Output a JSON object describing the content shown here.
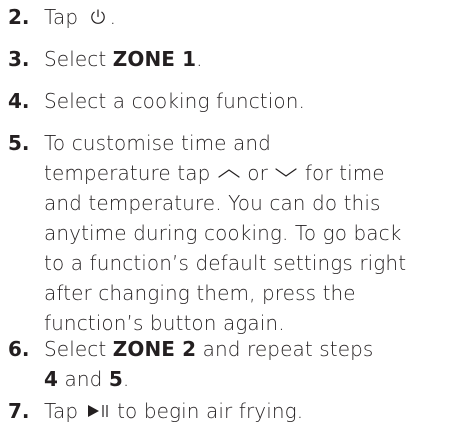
{
  "steps": [
    {
      "number": "2.",
      "pre": "Tap",
      "post": "."
    },
    {
      "number": "3.",
      "pre": "Select ",
      "bold": "ZONE 1",
      "post": "."
    },
    {
      "number": "4.",
      "text": "Select a cooking function."
    },
    {
      "number": "5.",
      "line1": "To customise time and",
      "line2_pre": "temperature tap ",
      "line2_mid": " or ",
      "line2_post": " for time",
      "line3": "and temperature. You can do this",
      "line4": "anytime during cooking. To go back",
      "line5": "to a function’s default settings right",
      "line6": "after changing them, press the",
      "line7": "function’s button again."
    },
    {
      "number": "6.",
      "line1_pre": "Select ",
      "line1_bold": "ZONE 2",
      "line1_post": " and repeat steps",
      "line2_bold_a": "4",
      "line2_mid": " and ",
      "line2_bold_b": "5",
      "line2_post": "."
    },
    {
      "number": "7.",
      "pre": "Tap ",
      "post": " to begin air frying."
    }
  ],
  "icons": {
    "power": "power-icon",
    "up": "chevron-up-icon",
    "down": "chevron-down-icon",
    "play_pause": "play-pause-icon"
  }
}
